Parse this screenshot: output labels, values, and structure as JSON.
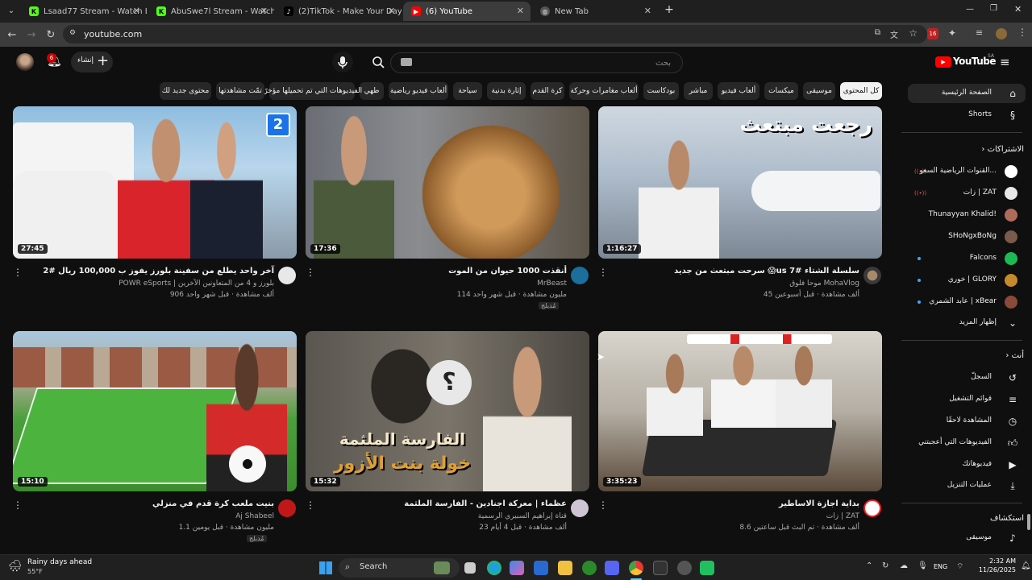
{
  "browser": {
    "tabs": [
      {
        "title": "Lsaad77 Stream - Watch Live o",
        "favicon": "kick-icon"
      },
      {
        "title": "AbuSwe7l Stream - Watch Live",
        "favicon": "kick-icon"
      },
      {
        "title": "(2)TikTok - Make Your Day",
        "favicon": "tiktok-icon"
      },
      {
        "title": "(6) YouTube",
        "favicon": "youtube-icon"
      },
      {
        "title": "New Tab",
        "favicon": "globe-icon"
      }
    ],
    "new_tab_symbol": "+",
    "url": "youtube.com",
    "extension_badge": "16"
  },
  "youtube": {
    "logo_text": "YouTube",
    "logo_region": "SA",
    "search_placeholder": "بحث",
    "create_label": "إنشاء",
    "notification_count": "6",
    "keyboard_icon": "keyboard-icon"
  },
  "chips": [
    "كل المحتوى",
    "موسيقى",
    "ميكسات",
    "ألعاب فيديو",
    "مباشر",
    "بودكاست",
    "ألعاب مغامرات وحركة",
    "كرة القدم",
    "إثارة بدنية",
    "سياحة",
    "ألعاب فيديو رياضية",
    "طهي",
    "الفيديوهات التي تم تحميلها مؤخرًا",
    "تمّت مشاهدتها",
    "محتوى جديد لك"
  ],
  "videos": [
    {
      "title": "سرحت مبتعث من جديد 😱us سلسلة الشتاء #7",
      "channel": "موحا فلوق MohaVlog",
      "stats": "45 ألف مشاهدة · قبل أسبوعين",
      "duration": "1:16:27",
      "badge": ""
    },
    {
      "title": "أنقذت 1000 حيوان من الموت",
      "channel": "MrBeast",
      "stats": "114 مليون مشاهدة · قبل شهر واحد",
      "duration": "17:36",
      "badge": "مُدبلج"
    },
    {
      "title": "آخر واحد يطلع من سفينة بلورز يفوز ب 100,000 ريال #2",
      "channel": "POWR eSports | بلورز و 4 من المتعاونين الآخرين",
      "stats": "906 ألف مشاهدة · قبل شهر واحد",
      "duration": "27:45",
      "badge": ""
    },
    {
      "title": "بداية اجازة الاساطير",
      "channel": "زات | ZAT",
      "stats": "8.6 ألف مشاهدة · تم البث قبل ساعتين",
      "duration": "3:35:23",
      "badge": ""
    },
    {
      "title": "عظماء | معركة اجنادين - الفارسة الملثمة",
      "channel": "قناة إبراهيم السبيري الرسمية",
      "stats": "23 ألف مشاهدة · قبل 4 أيام",
      "duration": "15:32",
      "badge": ""
    },
    {
      "title": "بنيت ملعب كرة قدم في منزلي",
      "channel": "Aj Shabeel",
      "stats": "1.1 مليون مشاهدة · قبل يومين",
      "duration": "15:10",
      "badge": "مُدبلج"
    }
  ],
  "thumb_texts": {
    "v1_overlay": "رجعت مبتعث",
    "v2_badge_number": "2",
    "v5_overlay_line1": "الفارسة الملثمة",
    "v5_overlay_line2": "خولة بنت الأزور",
    "v5_question": "؟"
  },
  "sidebar": {
    "main": [
      {
        "label": "الصفحة الرئيسية",
        "icon": "home-icon"
      },
      {
        "label": "Shorts",
        "icon": "shorts-icon"
      }
    ],
    "subs_header": "الاشتراكات",
    "subscriptions": [
      {
        "label": "القنوات الرياضية السعو...",
        "live": true,
        "color": "#ffffff"
      },
      {
        "label": "زات | ZAT",
        "live": true,
        "color": "#ffffff"
      },
      {
        "label": "Thunayyan Khalid!",
        "live": false,
        "color": "#b06a5a"
      },
      {
        "label": "SHoNgxBoNg",
        "live": false,
        "color": "#7a5a4a"
      },
      {
        "label": "Falcons",
        "live": false,
        "dot": true,
        "color": "#1db954"
      },
      {
        "label": "خوري | GLORY",
        "live": false,
        "dot": true,
        "color": "#c68a2a"
      },
      {
        "label": "عابد الشمري | xBear",
        "live": false,
        "dot": true,
        "color": "#8a4a3a"
      }
    ],
    "show_more": "إظهار المزيد",
    "you_header": "أنت",
    "you_items": [
      {
        "label": "السجلّ",
        "icon": "history-icon"
      },
      {
        "label": "قوائم التشغيل",
        "icon": "playlist-icon"
      },
      {
        "label": "المشاهدة لاحقًا",
        "icon": "clock-icon"
      },
      {
        "label": "الفيديوهات التي أعجبتني",
        "icon": "thumbs-up-icon"
      },
      {
        "label": "فيديوهاتك",
        "icon": "video-icon"
      },
      {
        "label": "عمليات التنزيل",
        "icon": "download-icon"
      }
    ],
    "explore_header": "استكشاف",
    "explore_items": [
      {
        "label": "موسيقى",
        "icon": "music-icon"
      }
    ]
  },
  "taskbar": {
    "weather_title": "Rainy days ahead",
    "weather_temp": "55°F",
    "search_placeholder": "Search",
    "lang": "ENG",
    "time": "2:32 AM",
    "date": "11/26/2025"
  },
  "colors": {
    "youtube_red": "#ff0000",
    "page_bg": "#0f0f0f",
    "chip_bg": "#272727"
  }
}
